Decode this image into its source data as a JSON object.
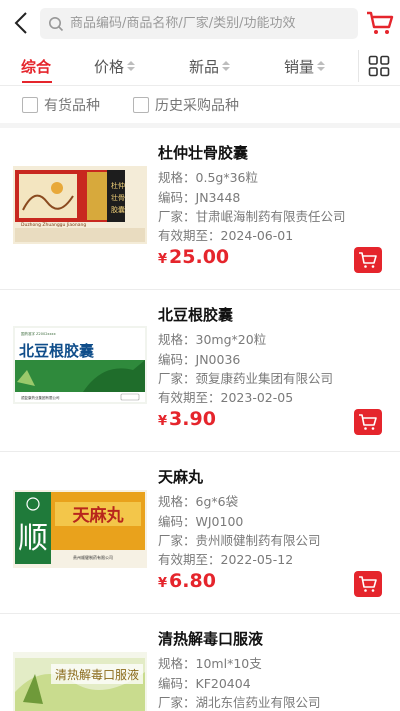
{
  "search": {
    "placeholder": "商品编码/商品名称/厂家/类别/功能功效"
  },
  "colors": {
    "accent": "#e5252c",
    "muted_text": "#7a7a7a",
    "search_bg": "#f2f2f2"
  },
  "icons": {
    "back": "back-arrow-icon",
    "search": "search-icon",
    "cart_top": "cart-icon",
    "grid_toggle": "grid-view-icon",
    "item_cart": "add-to-cart-icon"
  },
  "sort_tabs": [
    {
      "label": "综合",
      "active": true
    },
    {
      "label": "价格",
      "active": false
    },
    {
      "label": "新品",
      "active": false
    },
    {
      "label": "销量",
      "active": false
    }
  ],
  "filters": [
    {
      "label": "有货品种",
      "checked": false
    },
    {
      "label": "历史采购品种",
      "checked": false
    }
  ],
  "products": [
    {
      "name": "杜仲壮骨胶囊",
      "spec_label": "规格：",
      "spec": "0.5g*36粒",
      "code_label": "编码：",
      "code": "JN3448",
      "maker_label": "厂家：",
      "maker": "甘肃岷海制药有限责任公司",
      "expiry_label": "有效期至：",
      "expiry": "2024-06-01",
      "currency": "¥",
      "price": "25.00",
      "package_text": "杜仲壮骨胶囊",
      "package_subtext": "Duzhong Zhuanggu Jiaonang"
    },
    {
      "name": "北豆根胶囊",
      "spec_label": "规格：",
      "spec": "30mg*20粒",
      "code_label": "编码：",
      "code": "JN0036",
      "maker_label": "厂家：",
      "maker": "颈复康药业集团有限公司",
      "expiry_label": "有效期至：",
      "expiry": "2023-02-05",
      "currency": "¥",
      "price": "3.90",
      "package_text": "北豆根胶囊",
      "package_subtext": ""
    },
    {
      "name": "天麻丸",
      "spec_label": "规格：",
      "spec": "6g*6袋",
      "code_label": "编码：",
      "code": "WJ0100",
      "maker_label": "厂家：",
      "maker": "贵州顺健制药有限公司",
      "expiry_label": "有效期至：",
      "expiry": "2022-05-12",
      "currency": "¥",
      "price": "6.80",
      "package_text": "天麻丸",
      "package_subtext": "顺"
    },
    {
      "name": "清热解毒口服液",
      "spec_label": "规格：",
      "spec": "10ml*10支",
      "code_label": "编码：",
      "code": "KF20404",
      "maker_label": "厂家：",
      "maker": "湖北东信药业有限公司",
      "expiry_label": "",
      "expiry": "",
      "currency": "",
      "price": "",
      "package_text": "清热解毒口服液",
      "package_subtext": ""
    }
  ]
}
